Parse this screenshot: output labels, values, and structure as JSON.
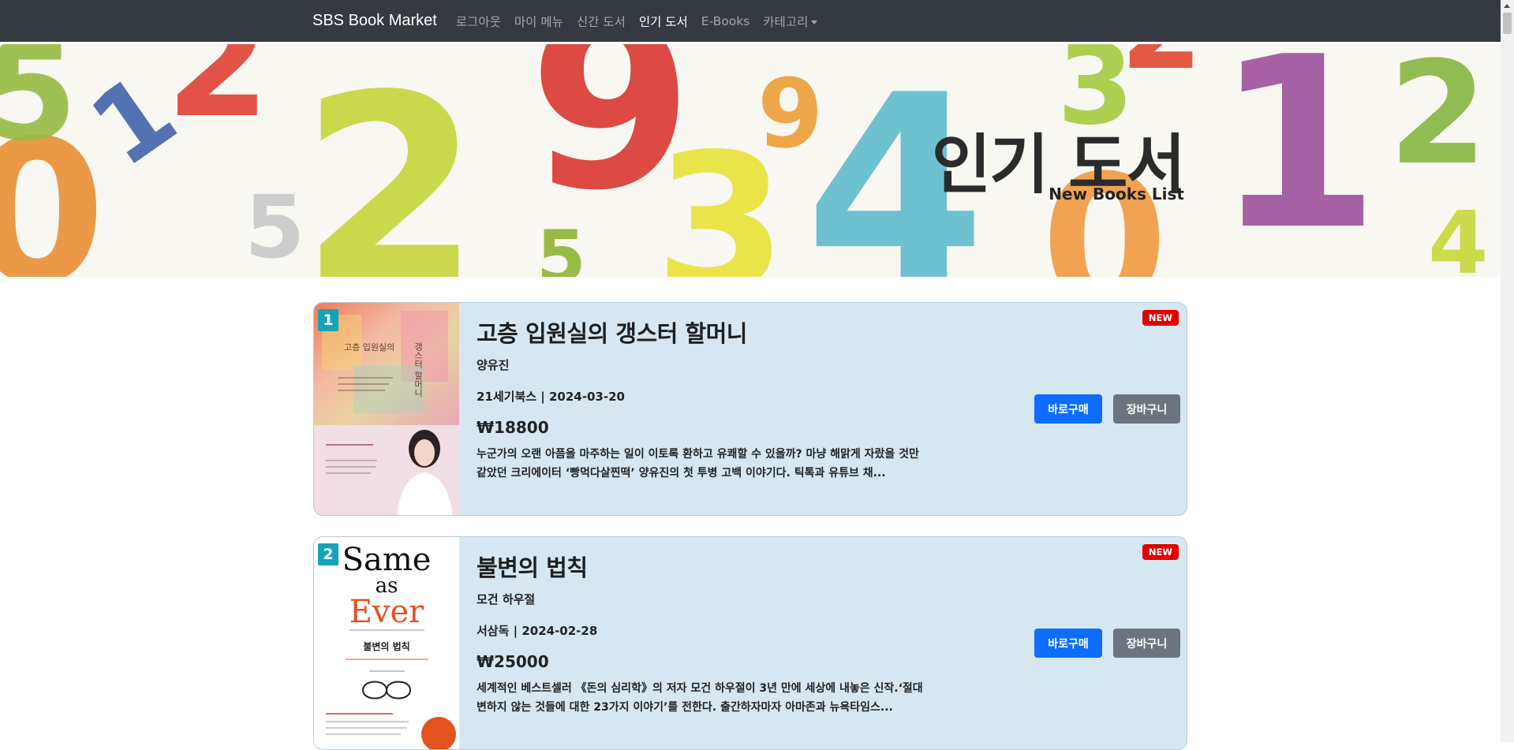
{
  "navbar": {
    "brand": "SBS Book Market",
    "links": [
      "로그아웃",
      "마이 메뉴",
      "신간 도서",
      "인기 도서",
      "E-Books",
      "카테고리"
    ]
  },
  "hero": {
    "title": "인기 도서",
    "subtitle": "New Books List"
  },
  "books": [
    {
      "rank": "1",
      "title": "고층 입원실의 갱스터 할머니",
      "author": "양유진",
      "publisher_date": "21세기북스 | 2024-03-20",
      "price": "₩18800",
      "description": "누군가의 오랜 아픔을 마주하는 일이 이토록 환하고 유쾌할 수 있을까? 마냥 해맑게 자랐을 것만 같았던 크리에이터 ‘빵먹다살찐떡’ 양유진의 첫 투병 고백 이야기다. 틱톡과 유튜브 채...",
      "badge": "NEW",
      "buy_label": "바로구매",
      "cart_label": "장바구니",
      "cover_title": "고층 입원실의",
      "cover_title2": "갱스터 할머니"
    },
    {
      "rank": "2",
      "title": "불변의 법칙",
      "author": "모건 하우절",
      "publisher_date": "서삼독 | 2024-02-28",
      "price": "₩25000",
      "description": "세계적인 베스트셀러 《돈의 심리학》의 저자 모건 하우절이 3년 만에 세상에 내놓은 신작.‘절대 변하지 않는 것들에 대한 23가지 이야기’를 전한다. 출간하자마자 아마존과 뉴욕타임스...",
      "badge": "NEW",
      "buy_label": "바로구매",
      "cart_label": "장바구니",
      "cover_title": "Same",
      "cover_title2": "as",
      "cover_title3": "Ever",
      "cover_ko": "불변의 법칙"
    }
  ],
  "colors": {
    "navbar": "#343a40",
    "card": "#d7e7f1",
    "rank_badge": "#17a2b8",
    "new_badge": "#e00000",
    "buy_button": "#0d6efd",
    "cart_button": "#6c757d"
  }
}
